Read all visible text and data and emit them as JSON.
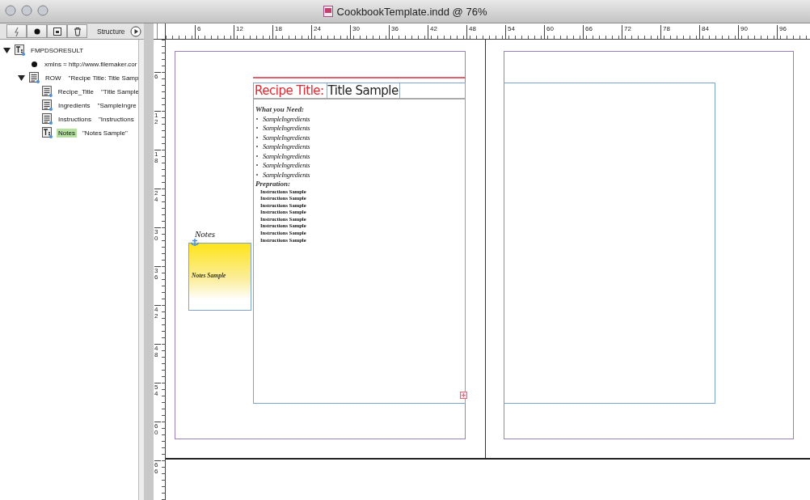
{
  "window": {
    "title": "CookbookTemplate.indd @ 76%"
  },
  "structure_panel": {
    "title": "Structure",
    "toolbar": [
      {
        "kind": "lightning"
      },
      {
        "kind": "dot"
      },
      {
        "kind": "frame"
      },
      {
        "kind": "trash"
      }
    ],
    "tree": [
      {
        "kind": "text-element",
        "name": "FMPDSORESULT",
        "selected": false,
        "expanded": true,
        "children": [
          {
            "kind": "attribute",
            "name": "xmlns = http://www.filemaker.cor",
            "selected": false
          },
          {
            "kind": "element",
            "name": "ROW",
            "value": "\"Recipe Title: Title Samp",
            "selected": false,
            "expanded": true,
            "children": [
              {
                "kind": "element",
                "name": "Recipe_Title",
                "value": "\"Title Sample",
                "selected": false
              },
              {
                "kind": "element",
                "name": "Ingredients",
                "value": "\"SampleIngre",
                "selected": false
              },
              {
                "kind": "element",
                "name": "Instructions",
                "value": "\"Instructions",
                "selected": false
              },
              {
                "kind": "text-element",
                "name": "Notes",
                "value": "\"Notes Sample\"",
                "selected": true
              }
            ]
          }
        ]
      }
    ]
  },
  "horizontal_ruler": [
    "6",
    "12",
    "18",
    "24",
    "30",
    "36",
    "42",
    "48",
    "54",
    "60",
    "66",
    "72",
    "78",
    "84",
    "90",
    "96"
  ],
  "vertical_ruler": [
    "6",
    "12",
    "18",
    "24",
    "30",
    "36",
    "42",
    "48",
    "54",
    "60",
    "66"
  ],
  "document": {
    "recipe_title": {
      "label": "Recipe Title:",
      "value": "Title Sample"
    },
    "ingredients_heading": "What you Need:",
    "ingredients": [
      "SampleIngredients",
      "SampleIngredients",
      "SampleIngredients",
      "SampleIngredients",
      "SampleIngredients",
      "SampleIngredients",
      "SampleIngredients"
    ],
    "preparation_heading": "Prepration:",
    "instructions": [
      "Instructions Sample",
      "Instructions Sample",
      "Instructions Sample",
      "Instructions Sample",
      "Instructions Sample",
      "Instructions Sample",
      "Instructions Sample",
      "Instructions Sample"
    ],
    "notes": {
      "label": "Notes",
      "text": "Notes Sample"
    }
  }
}
